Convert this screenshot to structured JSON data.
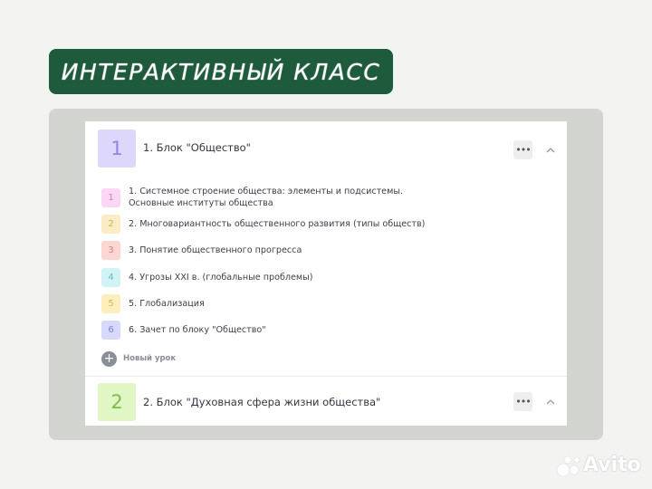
{
  "banner": {
    "title": "ИНТЕРАКТИВНЫЙ КЛАСС"
  },
  "blocks": [
    {
      "number": "1",
      "title": "1. Блок \"Общество\"",
      "num_bg": "#dcd7fb",
      "num_color": "#8f86e0"
    },
    {
      "number": "2",
      "title": "2. Блок \"Духовная сфера жизни общества\"",
      "num_bg": "#e0f6c4",
      "num_color": "#7dbb4a"
    }
  ],
  "block_menu_glyph": "•••",
  "lessons": [
    {
      "number": "1",
      "title": "1. Системное строение общества: элементы и подсистемы. Основные институты общества",
      "bg": "#fbd7f4",
      "color": "#d977c7"
    },
    {
      "number": "2",
      "title": "2. Многовариантность общественного развития (типы обществ)",
      "bg": "#fcecc5",
      "color": "#d8ad4d"
    },
    {
      "number": "3",
      "title": "3. Понятие общественного прогресса",
      "bg": "#fbd6d3",
      "color": "#d9827b"
    },
    {
      "number": "4",
      "title": "4. Угрозы XXI в. (глобальные проблемы)",
      "bg": "#d1f3f6",
      "color": "#5fbccb"
    },
    {
      "number": "5",
      "title": "5. Глобализация",
      "bg": "#fcefbd",
      "color": "#d8b64a"
    },
    {
      "number": "6",
      "title": "6. Зачет по блоку \"Общество\"",
      "bg": "#d7d9fb",
      "color": "#7d80d8"
    }
  ],
  "new_lesson": {
    "icon": "+",
    "label": "Новый урок"
  },
  "watermark": {
    "text": "Avito"
  }
}
